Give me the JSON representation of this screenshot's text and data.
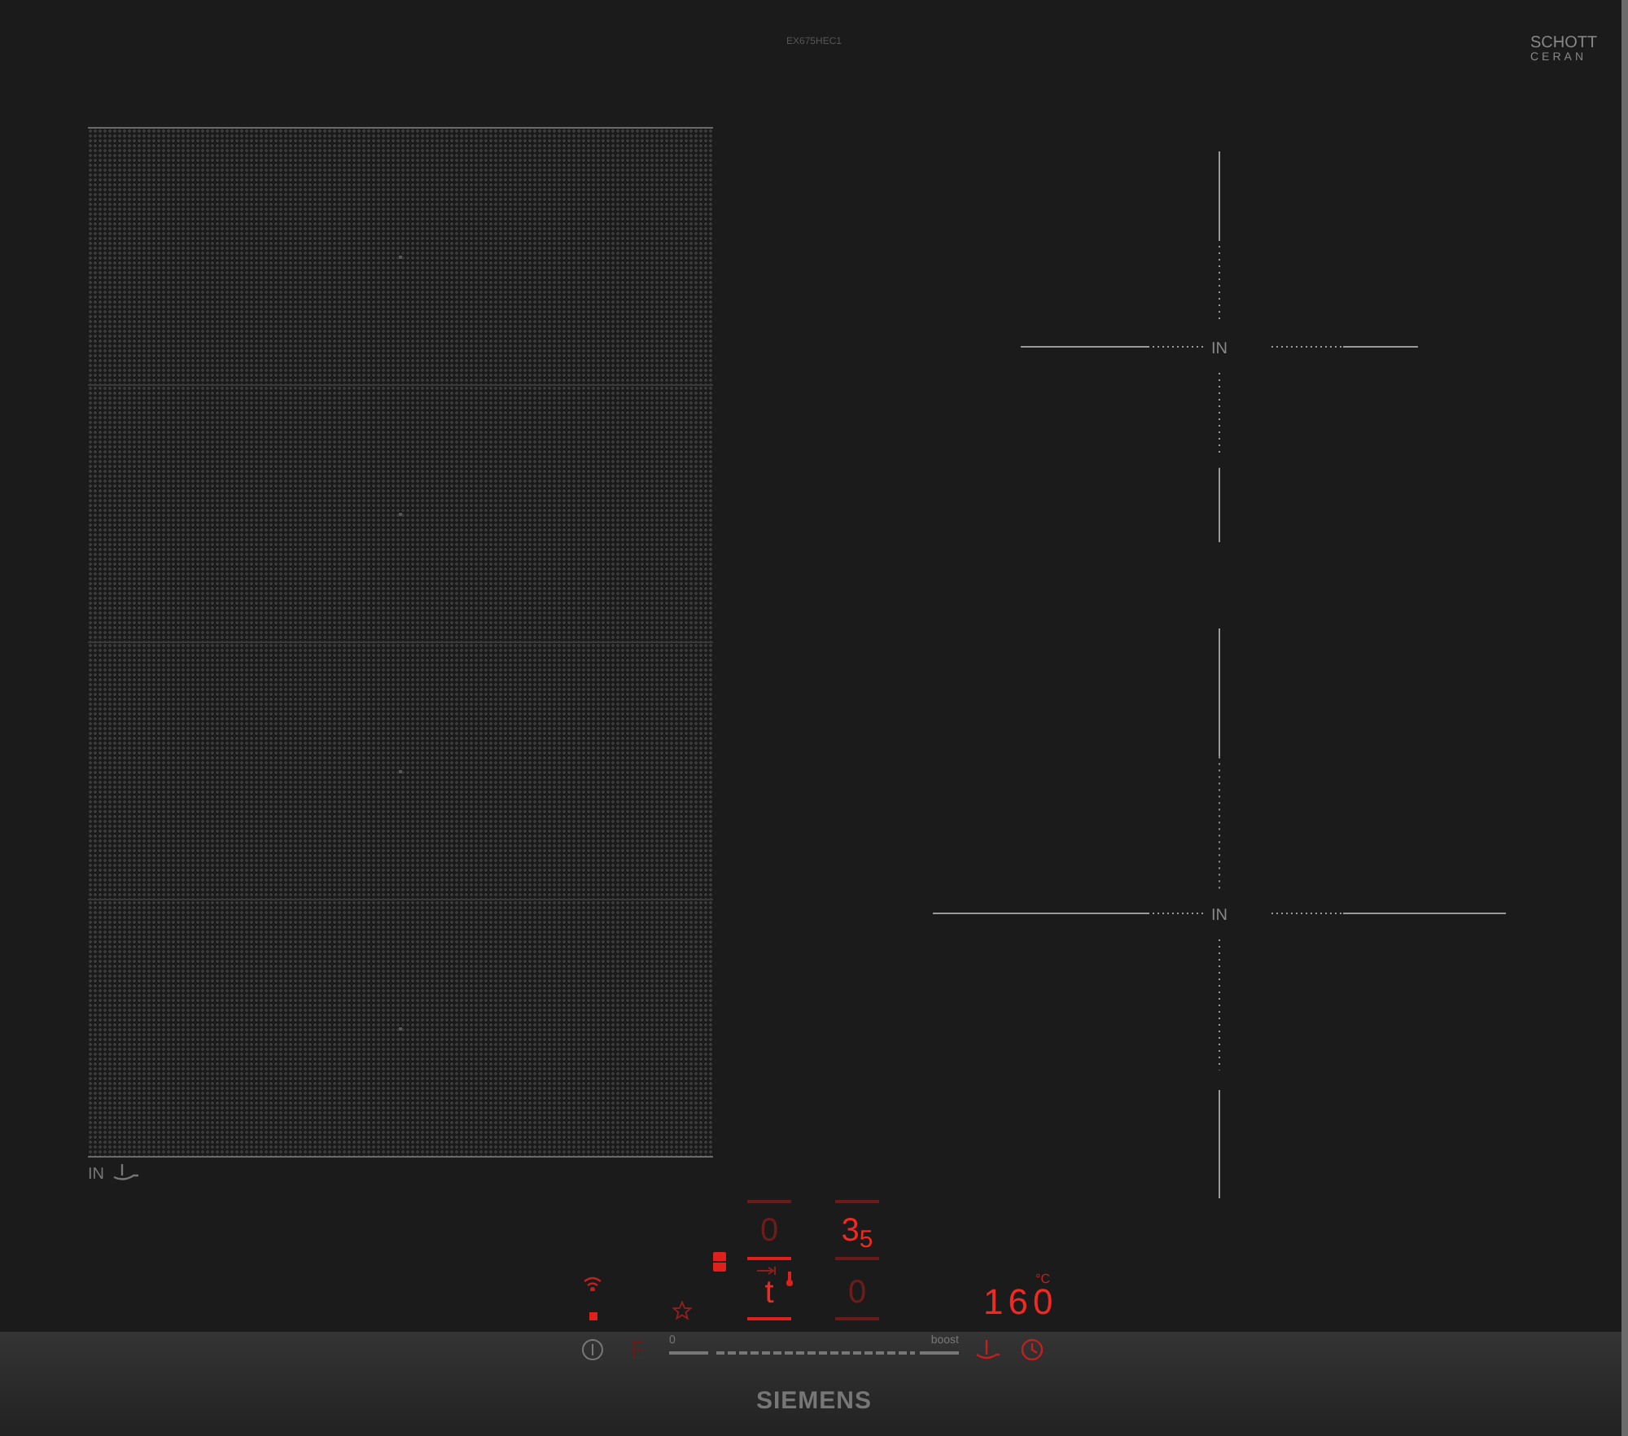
{
  "model_label": "EX675HEC1",
  "ceran_logo": {
    "line_1": "SCHOTT",
    "line_2": "CERAN"
  },
  "flex_zone": {
    "label": "IN"
  },
  "zones": [
    {
      "label": "IN"
    },
    {
      "label": "IN"
    }
  ],
  "zone_displays": [
    {
      "value": "0",
      "active": false
    },
    {
      "value": "3",
      "subscript": "5",
      "active": true
    },
    {
      "value": "t",
      "active": true
    },
    {
      "value": "0",
      "active": false
    }
  ],
  "temperature": {
    "value": "160",
    "unit": "°C"
  },
  "slider": {
    "min_label": "0",
    "max_label": "boost"
  },
  "brand": "SIEMENS"
}
